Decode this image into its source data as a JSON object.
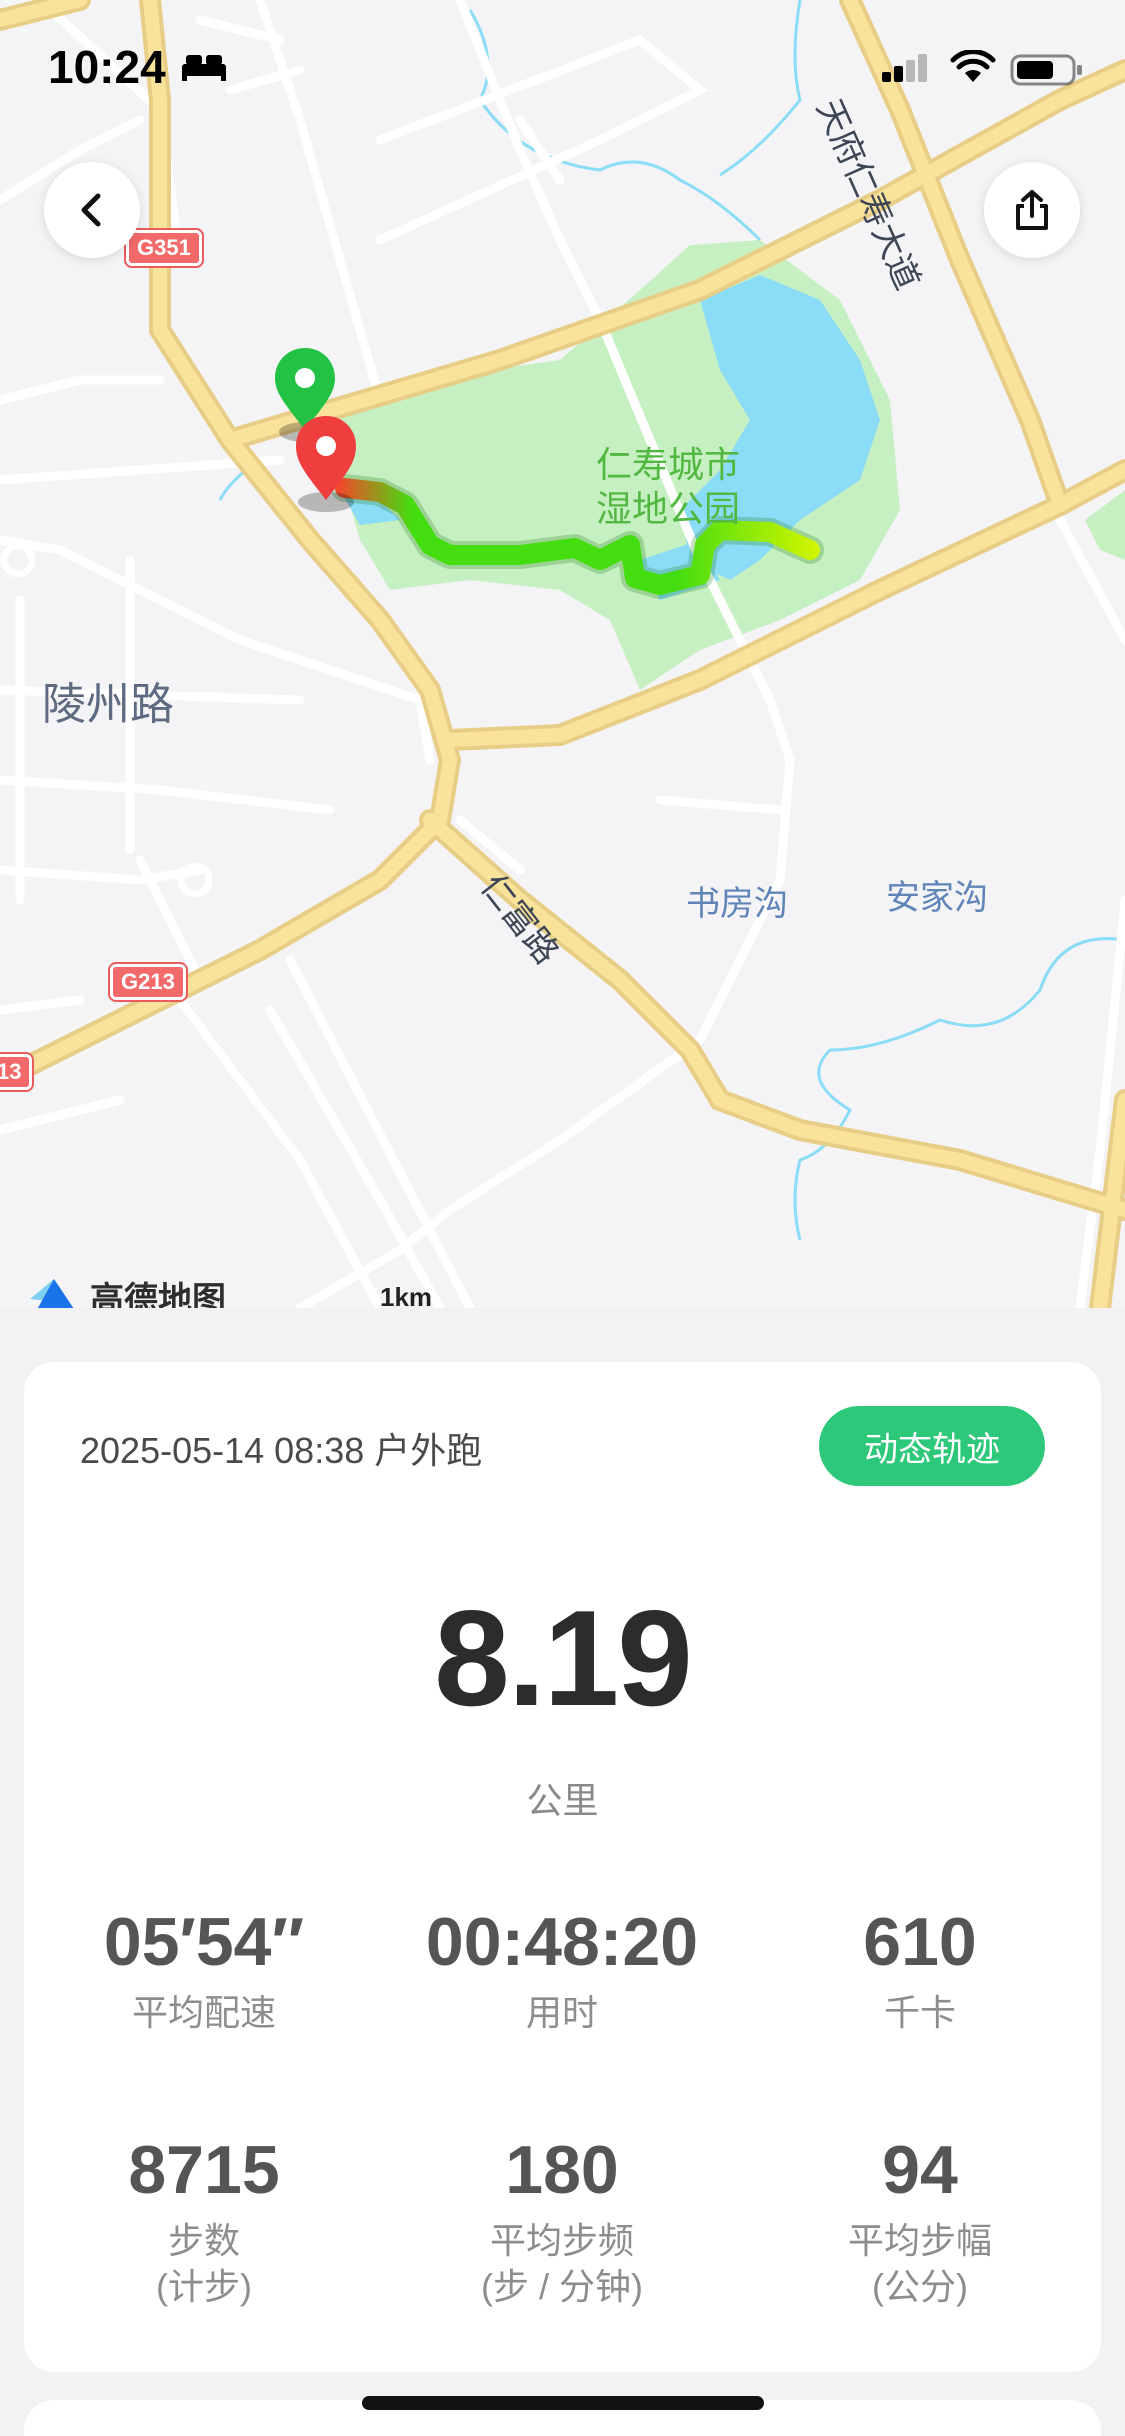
{
  "status_bar": {
    "time": "10:24"
  },
  "map": {
    "labels": {
      "street_lingzhou": "陵州路",
      "park_line1": "仁寿城市",
      "park_line2": "湿地公园",
      "shufanggou": "书房沟",
      "anjiagou": "安家沟",
      "tianfu": "天府仁寿大道",
      "renfu": "仁富路"
    },
    "shields": {
      "g351": "G351",
      "g213": "G213",
      "edge": "13"
    },
    "provider": "高德地图",
    "scale": "1km"
  },
  "workout": {
    "header": "2025-05-14 08:38 户外跑",
    "replay_button": "动态轨迹",
    "distance": "8.19",
    "distance_unit": "公里",
    "stats": [
      {
        "value": "05′54″",
        "label": "平均配速",
        "sublabel": ""
      },
      {
        "value": "00:48:20",
        "label": "用时",
        "sublabel": ""
      },
      {
        "value": "610",
        "label": "千卡",
        "sublabel": ""
      },
      {
        "value": "8715",
        "label": "步数",
        "sublabel": "(计步)"
      },
      {
        "value": "180",
        "label": "平均步频",
        "sublabel": "(步 / 分钟)"
      },
      {
        "value": "94",
        "label": "平均步幅",
        "sublabel": "(公分)"
      }
    ]
  },
  "colors": {
    "accent": "#2ec87a",
    "route_start": "#e7412f",
    "route_mid": "#44dd10",
    "route_end": "#d4f500",
    "park": "#c7f0c2",
    "water": "#8bdcf7",
    "main_road": "#f7dc8c"
  }
}
